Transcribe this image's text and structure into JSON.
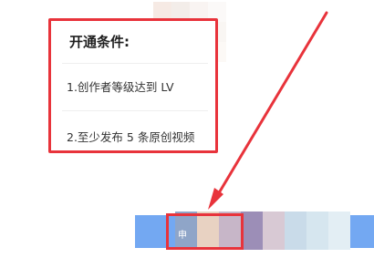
{
  "conditions": {
    "title": "开通条件:",
    "items": [
      {
        "label": "1.创作者等级达到 LV"
      },
      {
        "label": "2.至少发布 5 条原创视频"
      }
    ]
  },
  "apply_button": {
    "label": "申"
  },
  "colors": {
    "highlight": "#e8333b",
    "button_blue": "#73a8f2"
  }
}
